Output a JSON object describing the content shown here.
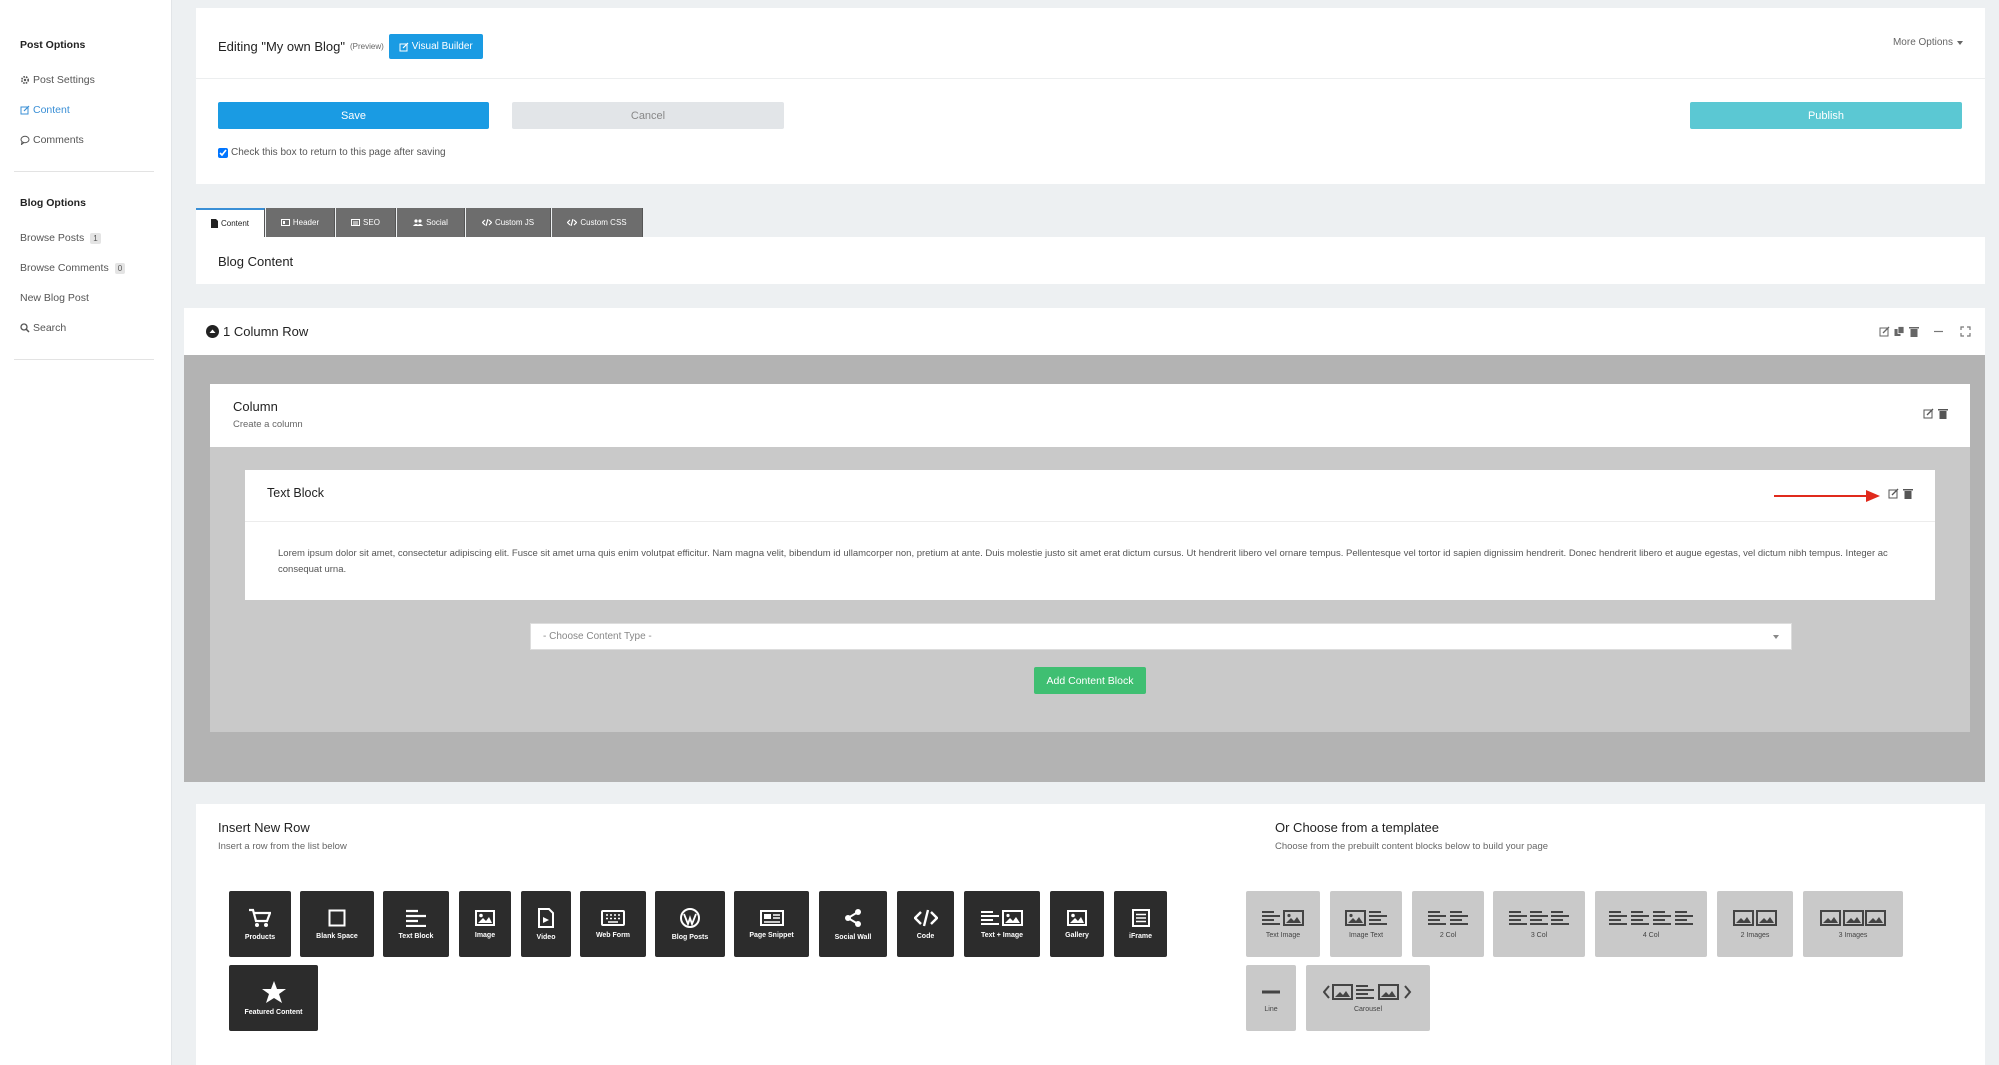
{
  "sidebar": {
    "post_options_title": "Post Options",
    "post_items": [
      {
        "label": "Post Settings",
        "icon": "gear-icon"
      },
      {
        "label": "Content",
        "icon": "edit-icon",
        "active": true
      },
      {
        "label": "Comments",
        "icon": "comment-icon"
      }
    ],
    "blog_options_title": "Blog Options",
    "blog_items": [
      {
        "label": "Browse Posts",
        "badge": "1"
      },
      {
        "label": "Browse Comments",
        "badge": "0"
      },
      {
        "label": "New Blog Post"
      },
      {
        "label": "Search",
        "icon": "search-icon"
      }
    ]
  },
  "header": {
    "editing_title": "Editing \"My own Blog\"",
    "preview_label": "(Preview)",
    "visual_builder_label": "Visual Builder",
    "more_options_label": "More Options"
  },
  "actions": {
    "save_label": "Save",
    "cancel_label": "Cancel",
    "publish_label": "Publish",
    "return_checkbox_label": "Check this box to return to this page after saving",
    "return_checkbox_checked": true
  },
  "tabs": [
    {
      "label": "Content",
      "icon": "file-icon",
      "active": true
    },
    {
      "label": "Header",
      "icon": "header-icon"
    },
    {
      "label": "SEO",
      "icon": "seo-icon"
    },
    {
      "label": "Social",
      "icon": "users-icon"
    },
    {
      "label": "Custom JS",
      "icon": "code-icon"
    },
    {
      "label": "Custom CSS",
      "icon": "code-icon"
    }
  ],
  "blog_content_title": "Blog Content",
  "row": {
    "title": "1 Column Row",
    "column_title": "Column",
    "column_subtitle": "Create a column",
    "text_block_title": "Text Block",
    "text_block_body": "Lorem ipsum dolor sit amet, consectetur adipiscing elit. Fusce sit amet urna quis enim volutpat efficitur. Nam magna velit, bibendum id ullamcorper non, pretium at ante. Duis molestie justo sit amet erat dictum cursus. Ut hendrerit libero vel ornare tempus. Pellentesque vel tortor id sapien dignissim hendrerit. Donec hendrerit libero et augue egestas, vel dictum nibh tempus. Integer ac consequat urna.",
    "content_type_placeholder": "- Choose Content Type -",
    "add_block_label": "Add Content Block"
  },
  "insert_row": {
    "title": "Insert New Row",
    "subtitle": "Insert a row from the list below",
    "items": [
      {
        "label": "Products",
        "icon": "cart-icon"
      },
      {
        "label": "Blank Space",
        "icon": "square-icon"
      },
      {
        "label": "Text Block",
        "icon": "text-icon"
      },
      {
        "label": "Image",
        "icon": "image-icon"
      },
      {
        "label": "Video",
        "icon": "video-file-icon"
      },
      {
        "label": "Web Form",
        "icon": "keyboard-icon"
      },
      {
        "label": "Blog Posts",
        "icon": "wordpress-icon"
      },
      {
        "label": "Page Snippet",
        "icon": "newspaper-icon"
      },
      {
        "label": "Social Wall",
        "icon": "share-icon"
      },
      {
        "label": "Code",
        "icon": "code-icon"
      },
      {
        "label": "Text + Image",
        "icon": "text-image-icon"
      },
      {
        "label": "Gallery",
        "icon": "gallery-icon"
      },
      {
        "label": "iFrame",
        "icon": "list-icon"
      },
      {
        "label": "Featured Content",
        "icon": "star-icon"
      }
    ]
  },
  "templates": {
    "title": "Or Choose from a templatee",
    "subtitle": "Choose from the prebuilt content blocks below to build your page",
    "items": [
      {
        "label": "Text Image"
      },
      {
        "label": "Image Text"
      },
      {
        "label": "2 Col"
      },
      {
        "label": "3 Col"
      },
      {
        "label": "4 Col"
      },
      {
        "label": "2 Images"
      },
      {
        "label": "3 Images"
      },
      {
        "label": "Line"
      },
      {
        "label": "Carousel"
      }
    ]
  },
  "colors": {
    "primary": "#1a9be3",
    "publish": "#5bc8d3",
    "add_block": "#3fbf72",
    "annotation_arrow": "#e02a1c"
  }
}
